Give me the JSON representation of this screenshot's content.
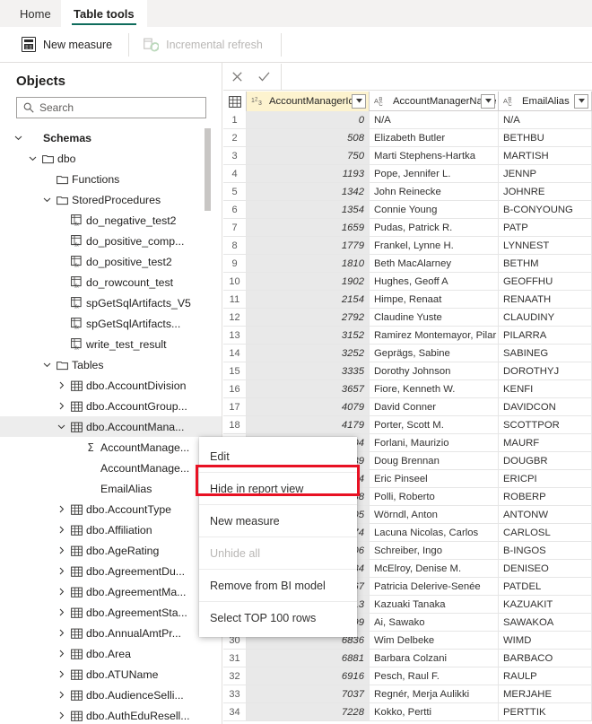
{
  "ribbon": {
    "tabs": [
      {
        "label": "Home",
        "active": false
      },
      {
        "label": "Table tools",
        "active": true
      }
    ],
    "commands": [
      {
        "label": "New measure",
        "icon": "calculator-icon",
        "disabled": false
      },
      {
        "label": "Incremental refresh",
        "icon": "refresh-icon",
        "disabled": true
      }
    ],
    "accent_color": "#0f6c5c"
  },
  "objects_pane": {
    "title": "Objects",
    "search": {
      "placeholder": "Search",
      "value": "",
      "icon": "search-icon"
    },
    "tree": [
      {
        "label": "Schemas",
        "indent": 0,
        "chevron": "down",
        "icon": "none",
        "bold": true,
        "selected": false
      },
      {
        "label": "dbo",
        "indent": 1,
        "chevron": "down",
        "icon": "folder",
        "bold": false,
        "selected": false
      },
      {
        "label": "Functions",
        "indent": 2,
        "chevron": "none",
        "icon": "folder",
        "bold": false,
        "selected": false
      },
      {
        "label": "StoredProcedures",
        "indent": 2,
        "chevron": "down",
        "icon": "folder",
        "bold": false,
        "selected": false
      },
      {
        "label": "do_negative_test2",
        "indent": 3,
        "chevron": "none",
        "icon": "procedure",
        "bold": false,
        "selected": false
      },
      {
        "label": "do_positive_comp...",
        "indent": 3,
        "chevron": "none",
        "icon": "procedure",
        "bold": false,
        "selected": false
      },
      {
        "label": "do_positive_test2",
        "indent": 3,
        "chevron": "none",
        "icon": "procedure",
        "bold": false,
        "selected": false
      },
      {
        "label": "do_rowcount_test",
        "indent": 3,
        "chevron": "none",
        "icon": "procedure",
        "bold": false,
        "selected": false
      },
      {
        "label": "spGetSqlArtifacts_V5",
        "indent": 3,
        "chevron": "none",
        "icon": "procedure",
        "bold": false,
        "selected": false
      },
      {
        "label": "spGetSqlArtifacts...",
        "indent": 3,
        "chevron": "none",
        "icon": "procedure",
        "bold": false,
        "selected": false
      },
      {
        "label": "write_test_result",
        "indent": 3,
        "chevron": "none",
        "icon": "procedure",
        "bold": false,
        "selected": false
      },
      {
        "label": "Tables",
        "indent": 2,
        "chevron": "down",
        "icon": "folder",
        "bold": false,
        "selected": false
      },
      {
        "label": "dbo.AccountDivision",
        "indent": 3,
        "chevron": "right",
        "icon": "table",
        "bold": false,
        "selected": false
      },
      {
        "label": "dbo.AccountGroup...",
        "indent": 3,
        "chevron": "right",
        "icon": "table",
        "bold": false,
        "selected": false
      },
      {
        "label": "dbo.AccountMana...",
        "indent": 3,
        "chevron": "down",
        "icon": "table",
        "bold": false,
        "selected": true
      },
      {
        "label": "AccountManage...",
        "indent": 4,
        "chevron": "none",
        "icon": "measure",
        "bold": false,
        "selected": false
      },
      {
        "label": "AccountManage...",
        "indent": 4,
        "chevron": "none",
        "icon": "none",
        "bold": false,
        "selected": false
      },
      {
        "label": "EmailAlias",
        "indent": 4,
        "chevron": "none",
        "icon": "none",
        "bold": false,
        "selected": false
      },
      {
        "label": "dbo.AccountType",
        "indent": 3,
        "chevron": "right",
        "icon": "table",
        "bold": false,
        "selected": false
      },
      {
        "label": "dbo.Affiliation",
        "indent": 3,
        "chevron": "right",
        "icon": "table",
        "bold": false,
        "selected": false
      },
      {
        "label": "dbo.AgeRating",
        "indent": 3,
        "chevron": "right",
        "icon": "table",
        "bold": false,
        "selected": false
      },
      {
        "label": "dbo.AgreementDu...",
        "indent": 3,
        "chevron": "right",
        "icon": "table",
        "bold": false,
        "selected": false
      },
      {
        "label": "dbo.AgreementMa...",
        "indent": 3,
        "chevron": "right",
        "icon": "table",
        "bold": false,
        "selected": false
      },
      {
        "label": "dbo.AgreementSta...",
        "indent": 3,
        "chevron": "right",
        "icon": "table",
        "bold": false,
        "selected": false
      },
      {
        "label": "dbo.AnnualAmtPr...",
        "indent": 3,
        "chevron": "right",
        "icon": "table",
        "bold": false,
        "selected": false
      },
      {
        "label": "dbo.Area",
        "indent": 3,
        "chevron": "right",
        "icon": "table",
        "bold": false,
        "selected": false
      },
      {
        "label": "dbo.ATUName",
        "indent": 3,
        "chevron": "right",
        "icon": "table",
        "bold": false,
        "selected": false
      },
      {
        "label": "dbo.AudienceSelli...",
        "indent": 3,
        "chevron": "right",
        "icon": "table",
        "bold": false,
        "selected": false
      },
      {
        "label": "dbo.AuthEduResell...",
        "indent": 3,
        "chevron": "right",
        "icon": "table",
        "bold": false,
        "selected": false
      }
    ]
  },
  "grid": {
    "toolbar": {
      "cancel_icon": "close-icon",
      "accept_icon": "checkmark-icon"
    },
    "columns": [
      {
        "name": "AccountManagerId",
        "type_icon": "123",
        "highlighted": true
      },
      {
        "name": "AccountManagerName",
        "type_icon": "ABC",
        "highlighted": false
      },
      {
        "name": "EmailAlias",
        "type_icon": "ABC",
        "highlighted": false
      }
    ],
    "rows": [
      {
        "n": "1",
        "id": "0",
        "name": "N/A",
        "alias": "N/A"
      },
      {
        "n": "2",
        "id": "508",
        "name": "Elizabeth Butler",
        "alias": "BETHBU"
      },
      {
        "n": "3",
        "id": "750",
        "name": "Marti Stephens-Hartka",
        "alias": "MARTISH"
      },
      {
        "n": "4",
        "id": "1193",
        "name": "Pope, Jennifer L.",
        "alias": "JENNP"
      },
      {
        "n": "5",
        "id": "1342",
        "name": "John Reinecke",
        "alias": "JOHNRE"
      },
      {
        "n": "6",
        "id": "1354",
        "name": "Connie Young",
        "alias": "B-CONYOUNG"
      },
      {
        "n": "7",
        "id": "1659",
        "name": "Pudas, Patrick R.",
        "alias": "PATP"
      },
      {
        "n": "8",
        "id": "1779",
        "name": "Frankel, Lynne H.",
        "alias": "LYNNEST"
      },
      {
        "n": "9",
        "id": "1810",
        "name": "Beth MacAlarney",
        "alias": "BETHM"
      },
      {
        "n": "10",
        "id": "1902",
        "name": "Hughes, Geoff A",
        "alias": "GEOFFHU"
      },
      {
        "n": "11",
        "id": "2154",
        "name": "Himpe, Renaat",
        "alias": "RENAATH"
      },
      {
        "n": "12",
        "id": "2792",
        "name": "Claudine Yuste",
        "alias": "CLAUDINY"
      },
      {
        "n": "13",
        "id": "3152",
        "name": "Ramirez Montemayor, Pilar",
        "alias": "PILARRA"
      },
      {
        "n": "14",
        "id": "3252",
        "name": "Geprägs, Sabine",
        "alias": "SABINEG"
      },
      {
        "n": "15",
        "id": "3335",
        "name": "Dorothy Johnson",
        "alias": "DOROTHYJ"
      },
      {
        "n": "16",
        "id": "3657",
        "name": "Fiore, Kenneth W.",
        "alias": "KENFI"
      },
      {
        "n": "17",
        "id": "4079",
        "name": "David Conner",
        "alias": "DAVIDCON"
      },
      {
        "n": "18",
        "id": "4179",
        "name": "Porter, Scott M.",
        "alias": "SCOTTPOR"
      },
      {
        "n": "19",
        "id": "4204",
        "name": "Forlani, Maurizio",
        "alias": "MAURF"
      },
      {
        "n": "20",
        "id": "4439",
        "name": "Doug Brennan",
        "alias": "DOUGBR"
      },
      {
        "n": "21",
        "id": "4574",
        "name": "Eric Pinseel",
        "alias": "ERICPI"
      },
      {
        "n": "22",
        "id": "4588",
        "name": "Polli, Roberto",
        "alias": "ROBERP"
      },
      {
        "n": "23",
        "id": "4605",
        "name": "Wörndl, Anton",
        "alias": "ANTONW"
      },
      {
        "n": "24",
        "id": "4774",
        "name": "Lacuna Nicolas, Carlos",
        "alias": "CARLOSL"
      },
      {
        "n": "25",
        "id": "5106",
        "name": "Schreiber, Ingo",
        "alias": "B-INGOS"
      },
      {
        "n": "26",
        "id": "5784",
        "name": "McElroy, Denise M.",
        "alias": "DENISEO"
      },
      {
        "n": "27",
        "id": "5867",
        "name": "Patricia Delerive-Senée",
        "alias": "PATDEL"
      },
      {
        "n": "28",
        "id": "5913",
        "name": "Kazuaki Tanaka",
        "alias": "KAZUAKIT"
      },
      {
        "n": "29",
        "id": "6499",
        "name": "Ai, Sawako",
        "alias": "SAWAKOA"
      },
      {
        "n": "30",
        "id": "6836",
        "name": "Wim Delbeke",
        "alias": "WIMD"
      },
      {
        "n": "31",
        "id": "6881",
        "name": "Barbara Colzani",
        "alias": "BARBACO"
      },
      {
        "n": "32",
        "id": "6916",
        "name": "Pesch, Raul F.",
        "alias": "RAULP"
      },
      {
        "n": "33",
        "id": "7037",
        "name": "Regnér, Merja Aulikki",
        "alias": "MERJAHE"
      },
      {
        "n": "34",
        "id": "7228",
        "name": "Kokko, Pertti",
        "alias": "PERTTIK"
      }
    ]
  },
  "context_menu": {
    "items": [
      {
        "label": "Edit",
        "disabled": false,
        "highlighted": false,
        "separator_after": true
      },
      {
        "label": "Hide in report view",
        "disabled": false,
        "highlighted": true,
        "separator_after": true
      },
      {
        "label": "New measure",
        "disabled": false,
        "highlighted": false,
        "separator_after": true
      },
      {
        "label": "Unhide all",
        "disabled": true,
        "highlighted": false,
        "separator_after": true
      },
      {
        "label": "Remove from BI model",
        "disabled": false,
        "highlighted": false,
        "separator_after": true
      },
      {
        "label": "Select TOP 100 rows",
        "disabled": false,
        "highlighted": false,
        "separator_after": false
      }
    ],
    "highlight_color": "#e81123"
  }
}
